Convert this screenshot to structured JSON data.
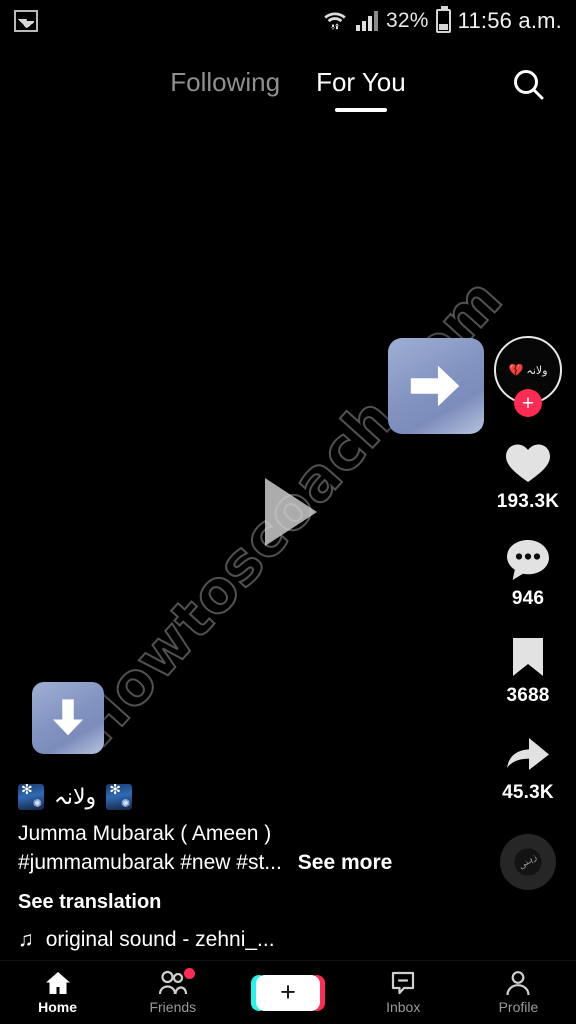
{
  "status_bar": {
    "gallery_icon": "photo-icon",
    "wifi_icon": "wifi-icon",
    "signal_icon": "signal-icon",
    "battery_percent": "32%",
    "battery_icon": "battery-icon",
    "time": "11:56 a.m."
  },
  "top_nav": {
    "tabs": [
      {
        "label": "Following",
        "active": false
      },
      {
        "label": "For You",
        "active": true
      }
    ],
    "search_icon": "search-icon"
  },
  "video": {
    "watermark": "Howtoscoach.com",
    "play_icon": "play-triangle-icon",
    "sticker_right_arrow": "right-arrow-emoji",
    "sticker_down_arrow": "down-arrow-emoji"
  },
  "actions": {
    "avatar": {
      "name": "ولانہ",
      "heart": "💔",
      "follow_label": "+"
    },
    "like": {
      "icon": "heart-icon",
      "count": "193.3K"
    },
    "comment": {
      "icon": "comment-icon",
      "count": "946"
    },
    "bookmark": {
      "icon": "bookmark-icon",
      "count": "3688"
    },
    "share": {
      "icon": "share-arrow-icon",
      "count": "45.3K"
    },
    "disc": {
      "icon": "music-disc-icon",
      "text": "زہنی"
    }
  },
  "caption": {
    "handle": "ولانہ",
    "emoji_left": "fireworks-emoji",
    "emoji_right": "fireworks-emoji",
    "line1": "Jumma Mubarak ( Ameen )",
    "line2": "#jummamubarak #new #st...",
    "see_more": "See more",
    "see_translation": "See translation",
    "music_icon": "music-note-icon",
    "music_title": "original sound - zehni_..."
  },
  "bottom_nav": {
    "items": [
      {
        "label": "Home",
        "icon": "home-icon",
        "active": true,
        "badge": false
      },
      {
        "label": "Friends",
        "icon": "friends-icon",
        "active": false,
        "badge": true
      },
      {
        "label": "Inbox",
        "icon": "inbox-icon",
        "active": false,
        "badge": false
      },
      {
        "label": "Profile",
        "icon": "profile-icon",
        "active": false,
        "badge": false
      }
    ],
    "create_label": "+"
  },
  "colors": {
    "accent_pink": "#fe2c55",
    "accent_cyan": "#25f4ee",
    "background": "#000000"
  }
}
